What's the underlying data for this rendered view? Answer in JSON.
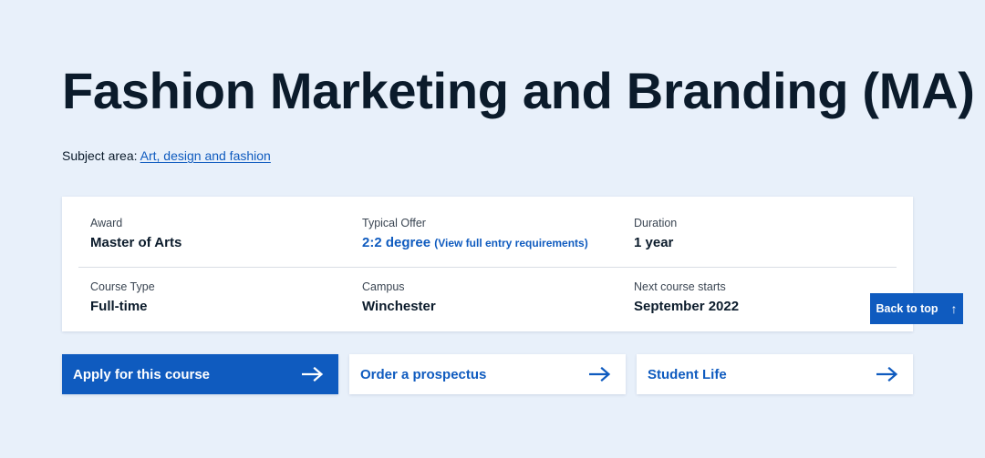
{
  "header": {
    "title": "Fashion Marketing and Branding (MA)"
  },
  "subject_area": {
    "label": "Subject area:",
    "link_text": "Art, design and fashion"
  },
  "course_info": {
    "award": {
      "label": "Award",
      "value": "Master of Arts"
    },
    "typical_offer": {
      "label": "Typical Offer",
      "value": "2:2 degree",
      "link_text": "(View full entry requirements)"
    },
    "duration": {
      "label": "Duration",
      "value": "1 year"
    },
    "course_type": {
      "label": "Course Type",
      "value": "Full-time"
    },
    "campus": {
      "label": "Campus",
      "value": "Winchester"
    },
    "next_start": {
      "label": "Next course starts",
      "value": "September 2022"
    }
  },
  "back_to_top": {
    "label": "Back to top",
    "icon": "arrow-up-icon"
  },
  "actions": {
    "apply_label": "Apply for this course",
    "prospectus_label": "Order a prospectus",
    "student_life_label": "Student Life",
    "icon": "arrow-right-icon"
  },
  "colors": {
    "background": "#e8f0fa",
    "brand_blue": "#0f5bbf",
    "text_dark": "#0b1b2b",
    "card_white": "#ffffff"
  }
}
